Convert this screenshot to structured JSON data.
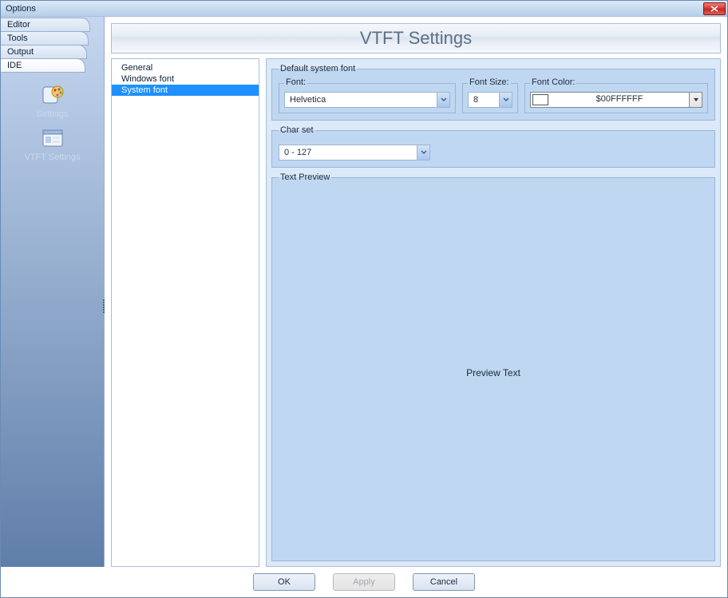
{
  "window": {
    "title": "Options"
  },
  "sidebar": {
    "tabs": [
      {
        "label": "Editor"
      },
      {
        "label": "Tools"
      },
      {
        "label": "Output"
      },
      {
        "label": "IDE"
      }
    ],
    "items": [
      {
        "label": "Settings",
        "icon": "palette-icon"
      },
      {
        "label": "VTFT Settings",
        "icon": "window-icon"
      }
    ]
  },
  "heading": "VTFT Settings",
  "tree": {
    "items": [
      {
        "label": "General"
      },
      {
        "label": "Windows font"
      },
      {
        "label": "System font"
      }
    ],
    "selected_index": 2
  },
  "settings": {
    "group_label": "Default system font",
    "font": {
      "label": "Font:",
      "value": "Helvetica"
    },
    "size": {
      "label": "Font Size:",
      "value": "8"
    },
    "color": {
      "label": "Font Color:",
      "value": "$00FFFFFF",
      "swatch": "#ffffff"
    },
    "charset": {
      "label": "Char set",
      "value": "0 - 127"
    },
    "preview": {
      "label": "Text Preview",
      "text": "Preview Text"
    }
  },
  "buttons": {
    "ok": "OK",
    "apply": "Apply",
    "cancel": "Cancel"
  }
}
